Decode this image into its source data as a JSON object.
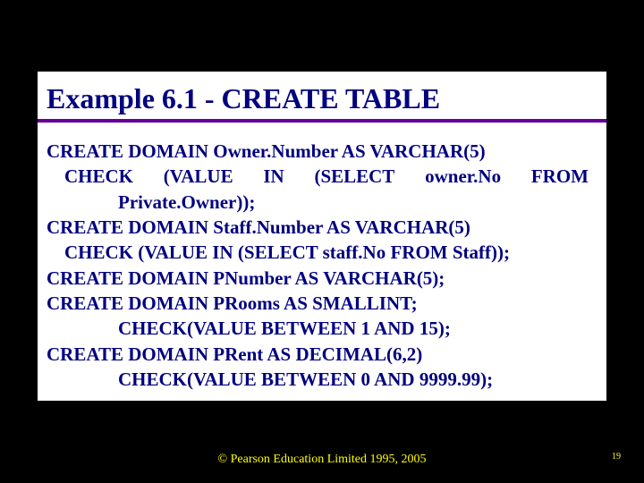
{
  "slide": {
    "title": "Example 6.1 - CREATE TABLE",
    "lines": {
      "l1": "CREATE DOMAIN Owner.Number AS VARCHAR(5)",
      "l2a": "CHECK",
      "l2b": "(VALUE",
      "l2c": "IN",
      "l2d": "(SELECT",
      "l2e": "owner.No",
      "l2f": "FROM",
      "l3": "Private.Owner));",
      "l4": "CREATE DOMAIN Staff.Number AS VARCHAR(5)",
      "l5": "CHECK (VALUE IN (SELECT staff.No FROM Staff));",
      "l6": "CREATE DOMAIN PNumber AS VARCHAR(5);",
      "l7": "CREATE DOMAIN PRooms AS SMALLINT;",
      "l8": "CHECK(VALUE BETWEEN 1 AND 15);",
      "l9": "CREATE DOMAIN PRent AS DECIMAL(6,2)",
      "l10": "CHECK(VALUE BETWEEN 0 AND 9999.99);"
    },
    "footer": "© Pearson Education Limited 1995, 2005",
    "page_number": "19"
  }
}
